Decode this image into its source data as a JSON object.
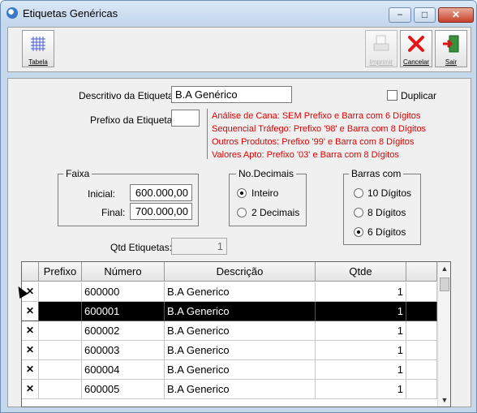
{
  "window": {
    "title": "Etiquetas Genéricas",
    "controls": {
      "minimize": "−",
      "maximize": "□",
      "close": "✕"
    }
  },
  "toolbar": {
    "tabela_label": "Tabela",
    "imprimir_label": "Imprimir",
    "cancelar_label": "Cancelar",
    "sair_label": "Sair"
  },
  "form": {
    "descritivo_label": "Descritivo da Etiqueta:",
    "descritivo_value": "B.A Genérico",
    "duplicar_label": "Duplicar",
    "prefixo_label": "Prefixo da Etiqueta:",
    "prefixo_value": "",
    "hints": [
      "Análise de Cana: SEM Prefixo e Barra com 6 Dígitos",
      "Sequencial Tráfego: Prefixo '98' e Barra com 8 Dígitos",
      "Outros Produtos: Prefixo '99' e Barra com 8 Dígitos",
      "Valores Apto: Prefixo '03' e Barra com 8 Dígitos"
    ],
    "faixa": {
      "title": "Faixa",
      "inicial_label": "Inicial:",
      "inicial_value": "600.000,00",
      "final_label": "Final:",
      "final_value": "700.000,00"
    },
    "decimais": {
      "title": "No.Decimais",
      "options": [
        "Inteiro",
        "2 Decimais"
      ],
      "selected": "Inteiro"
    },
    "barras": {
      "title": "Barras com",
      "options": [
        "10 Dígitos",
        "8 Dígitos",
        "6 Dígitos"
      ],
      "selected": "6 Dígitos"
    },
    "qtd_label": "Qtd Etiquetas:",
    "qtd_value": "1"
  },
  "grid": {
    "columns": [
      "Prefixo",
      "Número",
      "Descrição",
      "Qtde"
    ],
    "rows": [
      {
        "mark": "✕",
        "prefixo": "",
        "numero": "600000",
        "descricao": "B.A Generico",
        "qtde": "1"
      },
      {
        "mark": "✕",
        "prefixo": "",
        "numero": "600001",
        "descricao": "B.A Generico",
        "qtde": "1"
      },
      {
        "mark": "✕",
        "prefixo": "",
        "numero": "600002",
        "descricao": "B.A Generico",
        "qtde": "1"
      },
      {
        "mark": "✕",
        "prefixo": "",
        "numero": "600003",
        "descricao": "B.A Generico",
        "qtde": "1"
      },
      {
        "mark": "✕",
        "prefixo": "",
        "numero": "600004",
        "descricao": "B.A Generico",
        "qtde": "1"
      },
      {
        "mark": "✕",
        "prefixo": "",
        "numero": "600005",
        "descricao": "B.A Generico",
        "qtde": "1"
      }
    ],
    "selected_row": 1
  },
  "colors": {
    "hint_red": "#e00000",
    "selection": "#000000"
  }
}
